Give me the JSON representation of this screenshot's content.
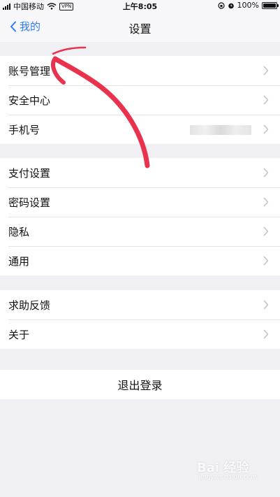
{
  "status_bar": {
    "carrier": "中国移动",
    "vpn": "VPN",
    "time": "上午8:05",
    "battery": "100%"
  },
  "nav": {
    "back_label": "我的",
    "title": "设置"
  },
  "groups": [
    {
      "items": [
        {
          "label": "账号管理"
        },
        {
          "label": "安全中心"
        },
        {
          "label": "手机号"
        }
      ]
    },
    {
      "items": [
        {
          "label": "支付设置"
        },
        {
          "label": "密码设置"
        },
        {
          "label": "隐私"
        },
        {
          "label": "通用"
        }
      ]
    },
    {
      "items": [
        {
          "label": "求助反馈"
        },
        {
          "label": "关于"
        }
      ]
    }
  ],
  "logout_label": "退出登录",
  "watermark": {
    "logo_text": "Bai 经验",
    "url": "jingyan.baidu.com"
  },
  "colors": {
    "accent": "#2f7cf6",
    "background": "#efeff4",
    "annotation": "#e8324e"
  }
}
